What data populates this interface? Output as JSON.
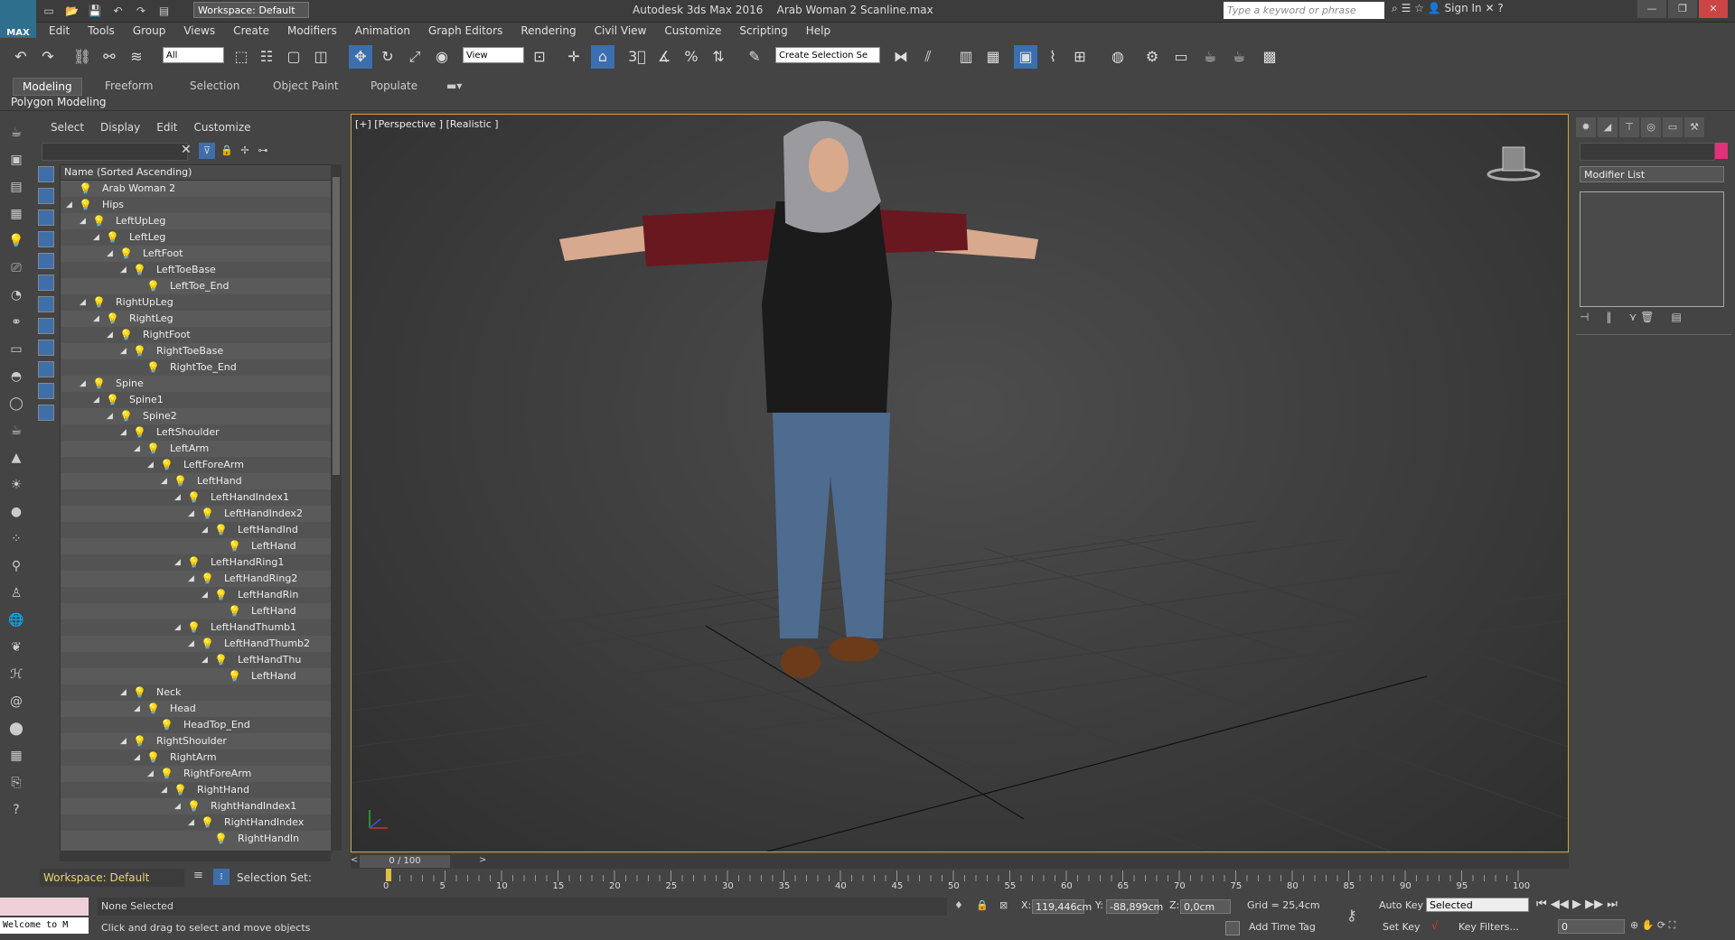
{
  "app": {
    "title": "Autodesk 3ds Max 2016",
    "file": "Arab Woman 2 Scanline.max",
    "logo": "MAX"
  },
  "workspace": {
    "label": "Workspace: Default"
  },
  "search": {
    "placeholder": "Type a keyword or phrase"
  },
  "signin": "Sign In",
  "menu": [
    "Edit",
    "Tools",
    "Group",
    "Views",
    "Create",
    "Modifiers",
    "Animation",
    "Graph Editors",
    "Rendering",
    "Civil View",
    "Customize",
    "Scripting",
    "Help"
  ],
  "toolbar": {
    "filter": "All",
    "ref_coord": "View",
    "selection_set": "Create Selection Se"
  },
  "ribbon": {
    "tabs": [
      "Modeling",
      "Freeform",
      "Selection",
      "Object Paint",
      "Populate"
    ],
    "sub": "Polygon Modeling"
  },
  "scene_explorer": {
    "menu": [
      "Select",
      "Display",
      "Edit",
      "Customize"
    ],
    "header": "Name (Sorted Ascending)",
    "rows": [
      {
        "name": "Arab Woman 2",
        "level": 0
      },
      {
        "name": "Hips",
        "level": 0
      },
      {
        "name": "LeftUpLeg",
        "level": 1
      },
      {
        "name": "LeftLeg",
        "level": 2
      },
      {
        "name": "LeftFoot",
        "level": 3
      },
      {
        "name": "LeftToeBase",
        "level": 4
      },
      {
        "name": "LeftToe_End",
        "level": 5
      },
      {
        "name": "RightUpLeg",
        "level": 1
      },
      {
        "name": "RightLeg",
        "level": 2
      },
      {
        "name": "RightFoot",
        "level": 3
      },
      {
        "name": "RightToeBase",
        "level": 4
      },
      {
        "name": "RightToe_End",
        "level": 5
      },
      {
        "name": "Spine",
        "level": 1
      },
      {
        "name": "Spine1",
        "level": 2
      },
      {
        "name": "Spine2",
        "level": 3
      },
      {
        "name": "LeftShoulder",
        "level": 4
      },
      {
        "name": "LeftArm",
        "level": 5
      },
      {
        "name": "LeftForeArm",
        "level": 6
      },
      {
        "name": "LeftHand",
        "level": 7
      },
      {
        "name": "LeftHandIndex1",
        "level": 8
      },
      {
        "name": "LeftHandIndex2",
        "level": 9
      },
      {
        "name": "LeftHandInd",
        "level": 10
      },
      {
        "name": "LeftHand",
        "level": 11
      },
      {
        "name": "LeftHandRing1",
        "level": 8
      },
      {
        "name": "LeftHandRing2",
        "level": 9
      },
      {
        "name": "LeftHandRin",
        "level": 10
      },
      {
        "name": "LeftHand",
        "level": 11
      },
      {
        "name": "LeftHandThumb1",
        "level": 8
      },
      {
        "name": "LeftHandThumb2",
        "level": 9
      },
      {
        "name": "LeftHandThu",
        "level": 10
      },
      {
        "name": "LeftHand",
        "level": 11
      },
      {
        "name": "Neck",
        "level": 4
      },
      {
        "name": "Head",
        "level": 5
      },
      {
        "name": "HeadTop_End",
        "level": 6
      },
      {
        "name": "RightShoulder",
        "level": 4
      },
      {
        "name": "RightArm",
        "level": 5
      },
      {
        "name": "RightForeArm",
        "level": 6
      },
      {
        "name": "RightHand",
        "level": 7
      },
      {
        "name": "RightHandIndex1",
        "level": 8
      },
      {
        "name": "RightHandIndex",
        "level": 9
      },
      {
        "name": "RightHandIn",
        "level": 10
      }
    ]
  },
  "viewport": {
    "label": "[+] [Perspective ] [Realistic ]"
  },
  "command_panel": {
    "modifier_list": "Modifier List"
  },
  "timeline": {
    "position": "0 / 100",
    "ticks": [
      "0",
      "5",
      "10",
      "15",
      "20",
      "25",
      "30",
      "35",
      "40",
      "45",
      "50",
      "55",
      "60",
      "65",
      "70",
      "75",
      "80",
      "85",
      "90",
      "95",
      "100"
    ]
  },
  "bottom": {
    "workspace": "Workspace: Default",
    "selection_set": "Selection Set:",
    "welcome": "Welcome to M",
    "status": "None Selected",
    "prompt": "Click and drag to select and move objects",
    "x_label": "X:",
    "x": "119,446cm",
    "y_label": "Y:",
    "y": "-88,899cm",
    "z_label": "Z:",
    "z": "0,0cm",
    "grid": "Grid = 25,4cm",
    "add_time_tag": "Add Time Tag",
    "auto_key": "Auto Key",
    "set_key": "Set Key",
    "key_mode": "Selected",
    "key_filters": "Key Filters...",
    "frame": "0"
  }
}
